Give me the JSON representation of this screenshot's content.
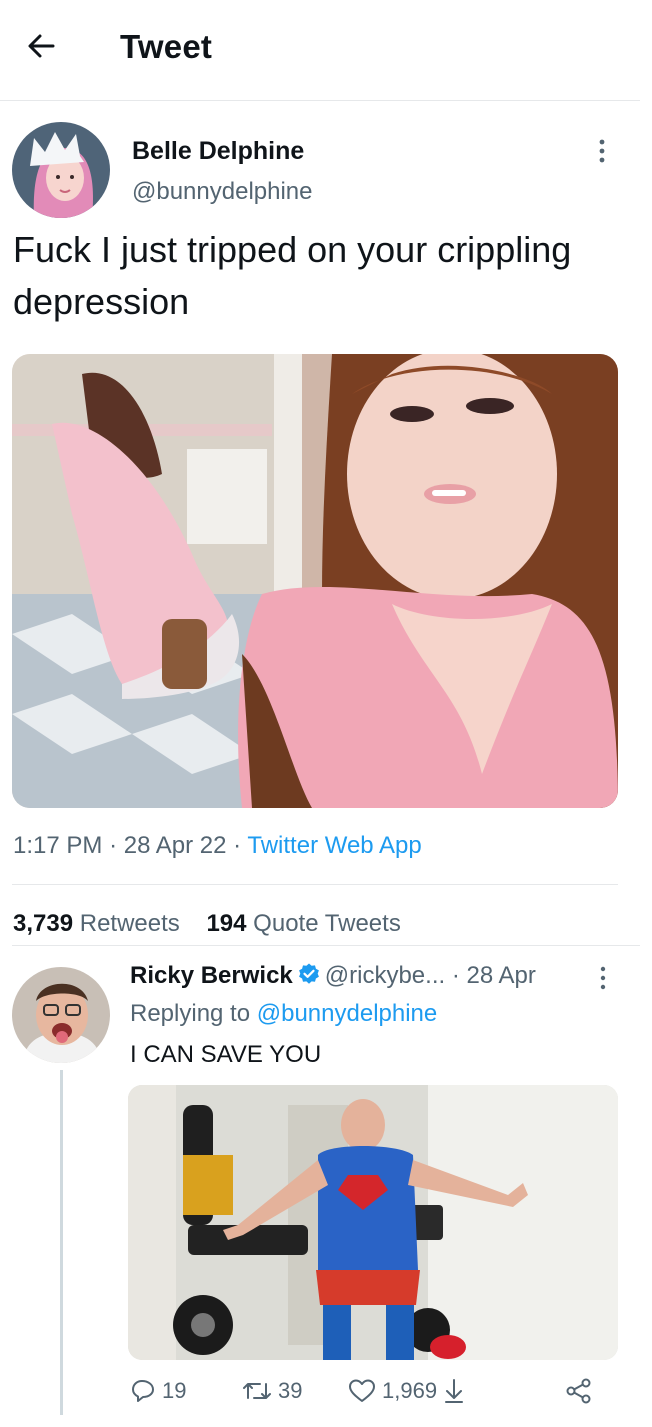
{
  "header": {
    "title": "Tweet",
    "back_icon": "arrow-left-icon"
  },
  "tweet": {
    "author": {
      "name": "Belle Delphine",
      "handle": "@bunnydelphine"
    },
    "text": "Fuck I just tripped on your crippling depression",
    "time": "1:17 PM",
    "sep1": "·",
    "date": "28 Apr 22",
    "sep2": "·",
    "source": "Twitter Web App",
    "retweets": {
      "count": "3,739",
      "label": "Retweets"
    },
    "quotes": {
      "count": "194",
      "label": "Quote Tweets"
    }
  },
  "reply": {
    "author": {
      "name": "Ricky Berwick",
      "handle": "@rickybe...",
      "verified": true
    },
    "sep": "·",
    "date": "28 Apr",
    "replying_prefix": "Replying to",
    "replying_to": "@bunnydelphine",
    "text": "I CAN SAVE YOU",
    "actions": {
      "replies": "19",
      "retweets": "39",
      "likes": "1,969"
    }
  },
  "colors": {
    "accent": "#1d9bf0",
    "secondary_text": "#536471",
    "divider": "#e6e8ea"
  }
}
